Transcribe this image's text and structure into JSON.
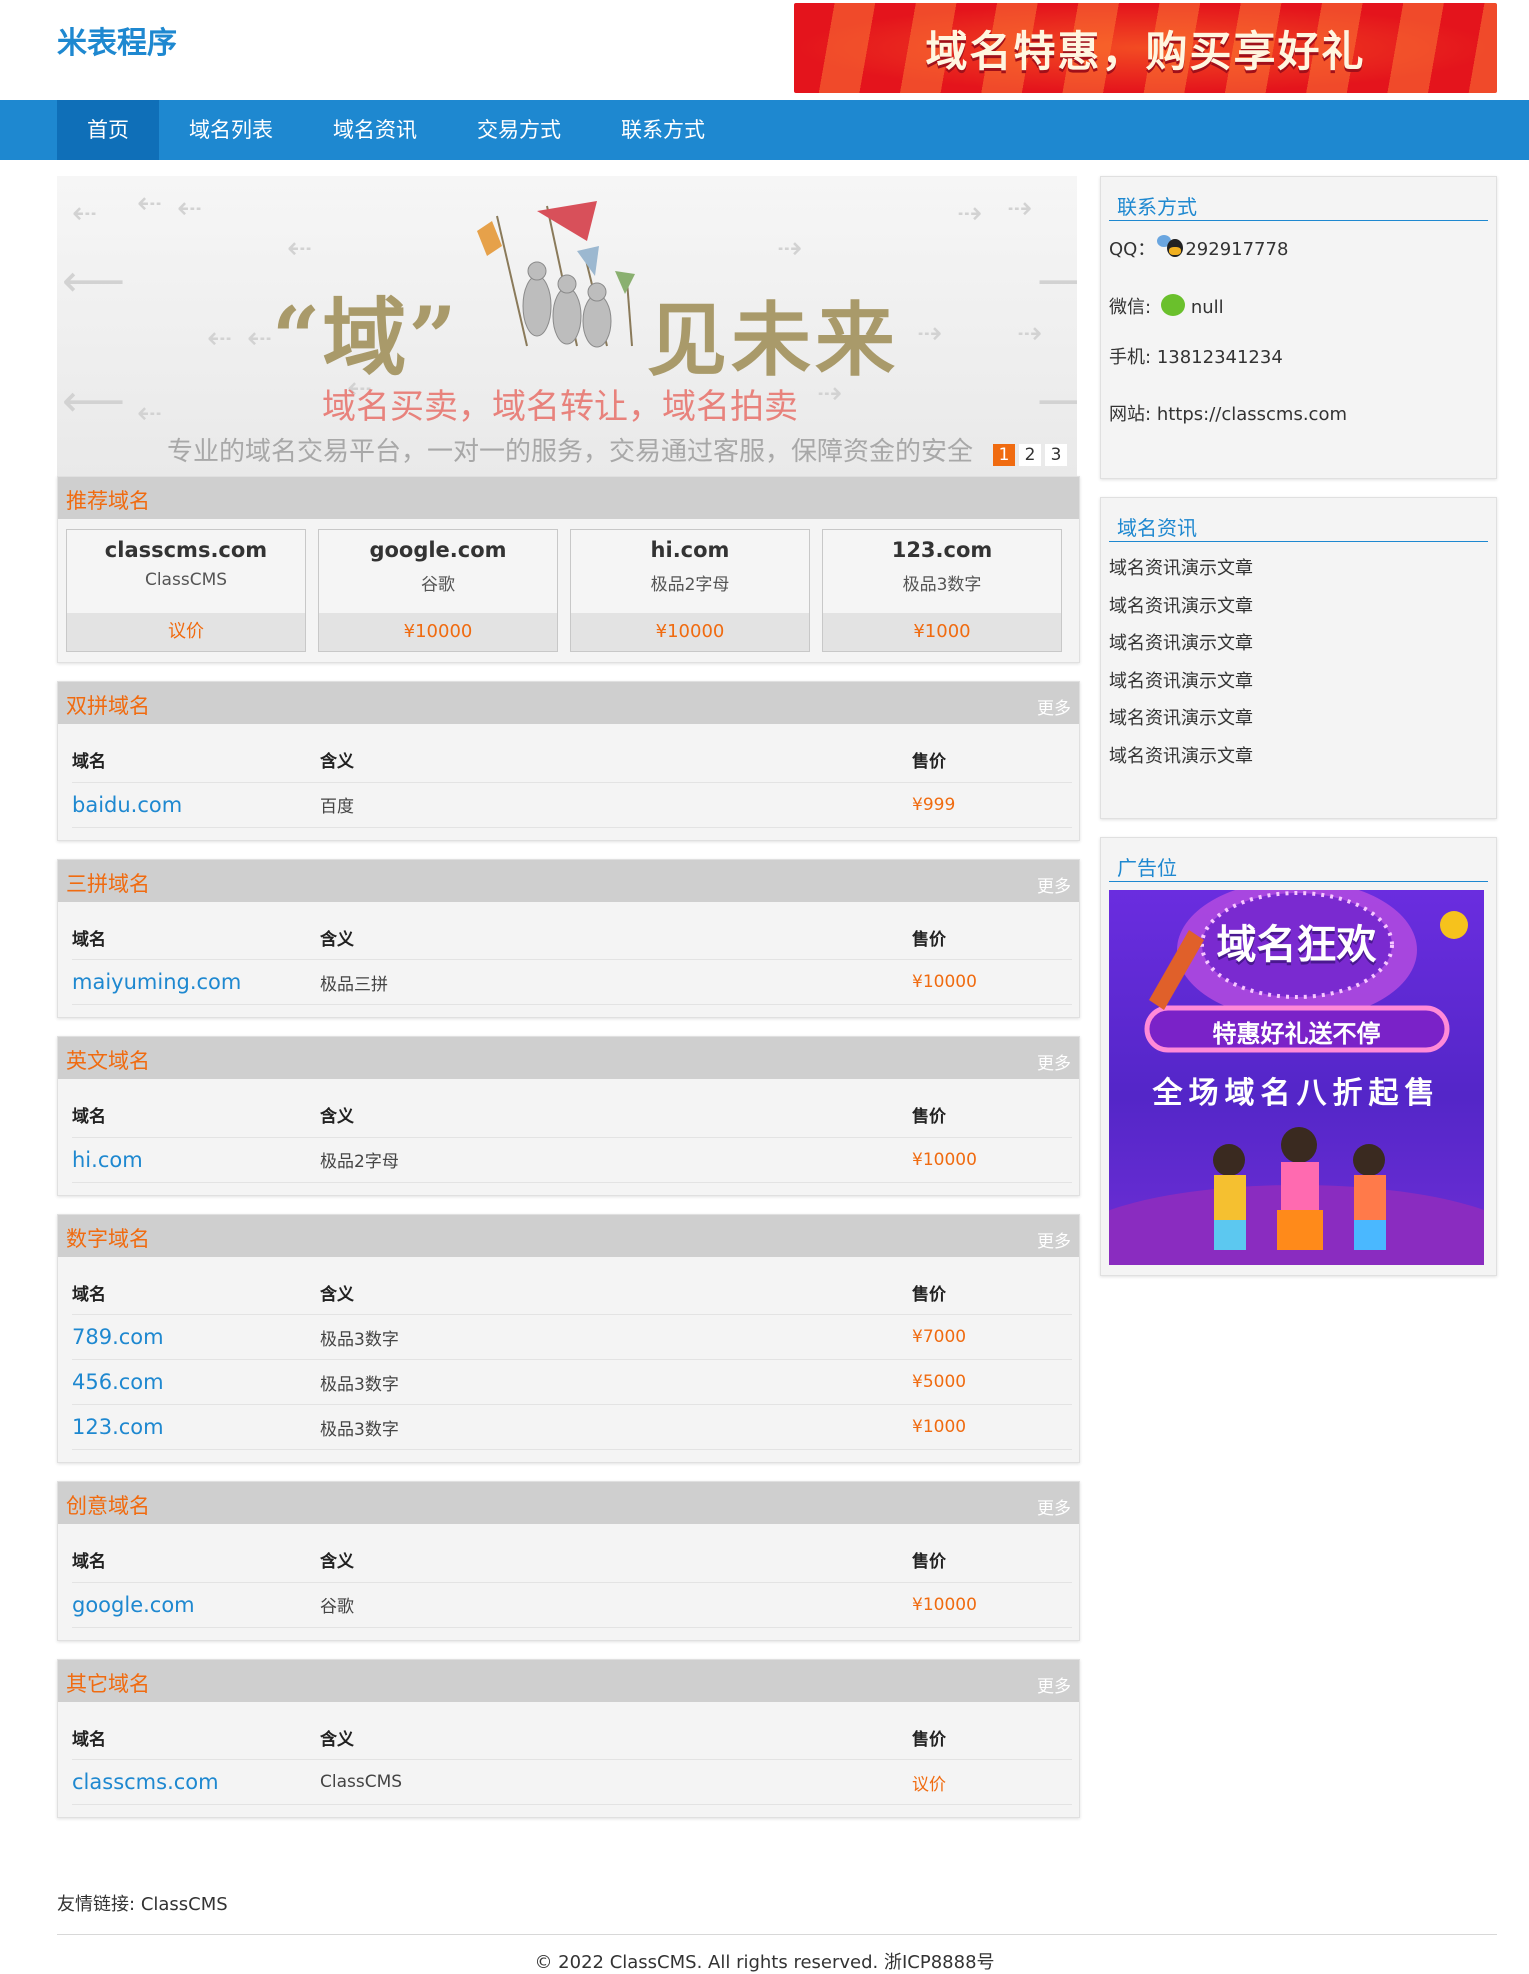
{
  "site": {
    "logo": "米表程序",
    "top_banner_text": "域名特惠，购买享好礼"
  },
  "nav": [
    {
      "label": "首页",
      "active": true
    },
    {
      "label": "域名列表"
    },
    {
      "label": "域名资讯"
    },
    {
      "label": "交易方式"
    },
    {
      "label": "联系方式"
    }
  ],
  "slider": {
    "headline_a": "“域”",
    "headline_b": "见未来",
    "subtitle": "域名买卖，域名转让，域名拍卖",
    "description": "专业的域名交易平台，一对一的服务，交易通过客服，保障资金的安全",
    "pages": [
      "1",
      "2",
      "3"
    ],
    "current_page": "1"
  },
  "recommended": {
    "title": "推荐域名",
    "items": [
      {
        "name": "classcms.com",
        "meaning": "ClassCMS",
        "price": "议价"
      },
      {
        "name": "google.com",
        "meaning": "谷歌",
        "price": "¥10000"
      },
      {
        "name": "hi.com",
        "meaning": "极品2字母",
        "price": "¥10000"
      },
      {
        "name": "123.com",
        "meaning": "极品3数字",
        "price": "¥1000"
      }
    ]
  },
  "table_headers": {
    "name": "域名",
    "meaning": "含义",
    "price": "售价"
  },
  "more_label": "更多",
  "sections": [
    {
      "title": "双拼域名",
      "rows": [
        {
          "name": "baidu.com",
          "meaning": "百度",
          "price": "¥999"
        }
      ]
    },
    {
      "title": "三拼域名",
      "rows": [
        {
          "name": "maiyuming.com",
          "meaning": "极品三拼",
          "price": "¥10000"
        }
      ]
    },
    {
      "title": "英文域名",
      "rows": [
        {
          "name": "hi.com",
          "meaning": "极品2字母",
          "price": "¥10000"
        }
      ]
    },
    {
      "title": "数字域名",
      "rows": [
        {
          "name": "789.com",
          "meaning": "极品3数字",
          "price": "¥7000"
        },
        {
          "name": "456.com",
          "meaning": "极品3数字",
          "price": "¥5000"
        },
        {
          "name": "123.com",
          "meaning": "极品3数字",
          "price": "¥1000"
        }
      ]
    },
    {
      "title": "创意域名",
      "rows": [
        {
          "name": "google.com",
          "meaning": "谷歌",
          "price": "¥10000"
        }
      ]
    },
    {
      "title": "其它域名",
      "rows": [
        {
          "name": "classcms.com",
          "meaning": "ClassCMS",
          "price": "议价"
        }
      ]
    }
  ],
  "contact": {
    "title": "联系方式",
    "qq_label": "QQ：",
    "qq": "292917778",
    "wechat_label": "微信:",
    "wechat": "null",
    "phone_label": "手机:",
    "phone": "13812341234",
    "site_label": "网站:",
    "site": "https://classcms.com"
  },
  "news": {
    "title": "域名资讯",
    "items": [
      "域名资讯演示文章",
      "域名资讯演示文章",
      "域名资讯演示文章",
      "域名资讯演示文章",
      "域名资讯演示文章",
      "域名资讯演示文章"
    ]
  },
  "ad": {
    "title": "广告位",
    "line1": "域名狂欢",
    "line2": "特惠好礼送不停",
    "line3": "全场域名八折起售"
  },
  "footer": {
    "friend_label": "友情链接:",
    "friend_link": "ClassCMS",
    "copyright": "© 2022 ClassCMS. All rights reserved. 浙ICP8888号"
  },
  "colors": {
    "primary": "#1e88d0",
    "accent": "#f06b10",
    "nav_active": "#0f6fb8"
  }
}
